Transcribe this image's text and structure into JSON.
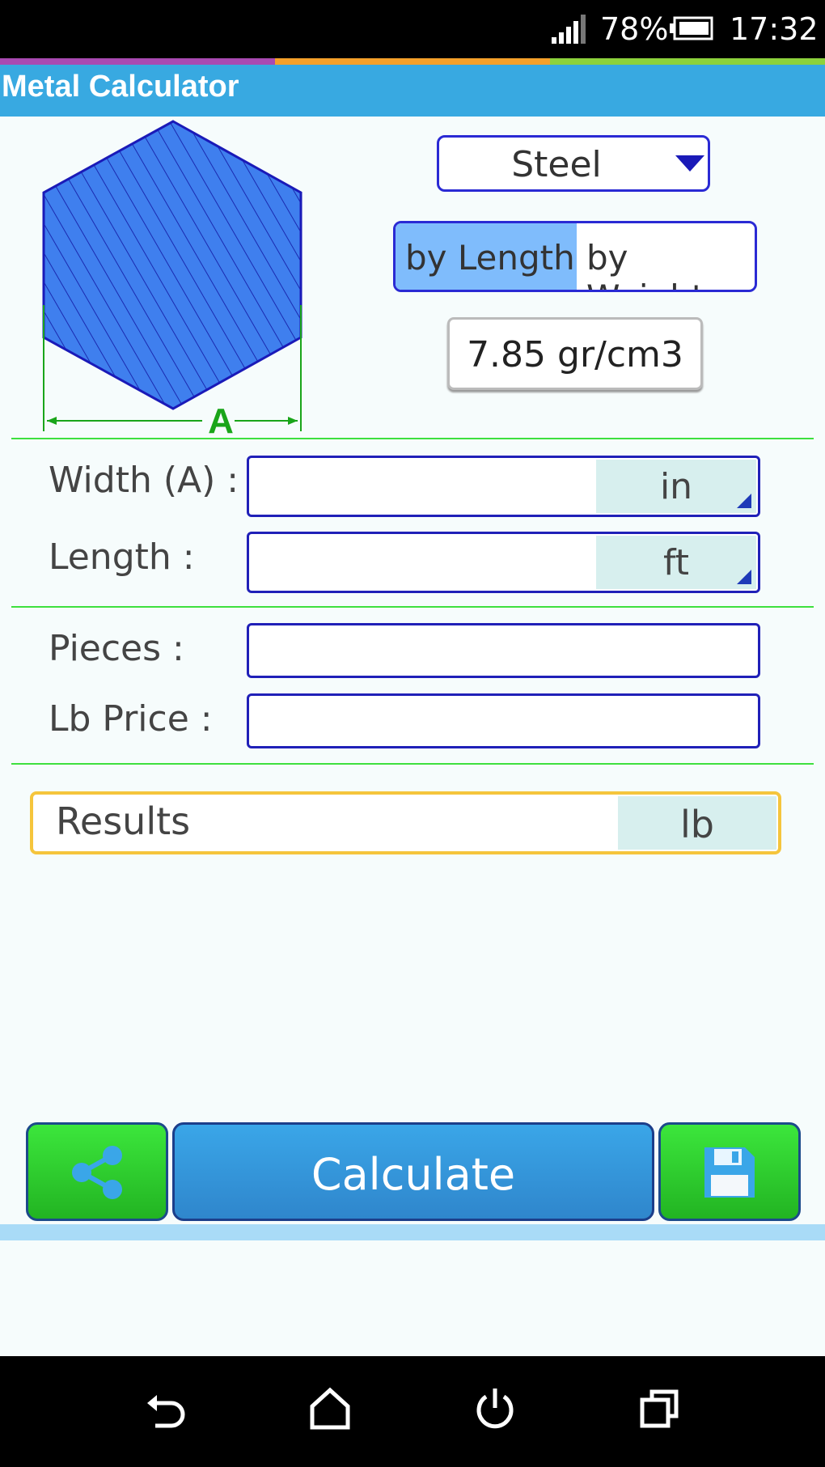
{
  "status_bar": {
    "battery": "78%",
    "time": "17:32"
  },
  "app": {
    "title": "Metal Calculator"
  },
  "shape": {
    "dimension_label": "A"
  },
  "material": {
    "selected": "Steel"
  },
  "mode": {
    "by_length": "by Length",
    "by_weight": "by Weight",
    "selected": "by Length"
  },
  "density": {
    "value": "7.85 gr/cm3"
  },
  "form": {
    "width": {
      "label": "Width (A) :",
      "value": "",
      "unit": "in"
    },
    "length": {
      "label": "Length :",
      "value": "",
      "unit": "ft"
    },
    "pieces": {
      "label": "Pieces :",
      "value": ""
    },
    "lb_price": {
      "label": "Lb Price :",
      "value": ""
    }
  },
  "results": {
    "label": "Results",
    "unit": "lb"
  },
  "buttons": {
    "calculate": "Calculate",
    "share_icon": "share-icon",
    "save_icon": "save-icon"
  },
  "colors": {
    "title_bar": "#38a9e1",
    "accent_green": "#3ee03e",
    "hex_fill": "#3a78ea",
    "results_border": "#f5c53c"
  }
}
